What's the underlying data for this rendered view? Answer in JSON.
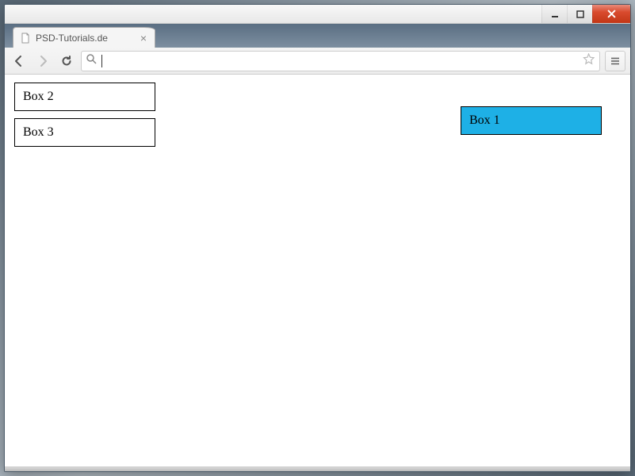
{
  "tab": {
    "title": "PSD-Tutorials.de"
  },
  "url": {
    "value": ""
  },
  "content": {
    "box1": "Box 1",
    "box2": "Box 2",
    "box3": "Box 3"
  }
}
